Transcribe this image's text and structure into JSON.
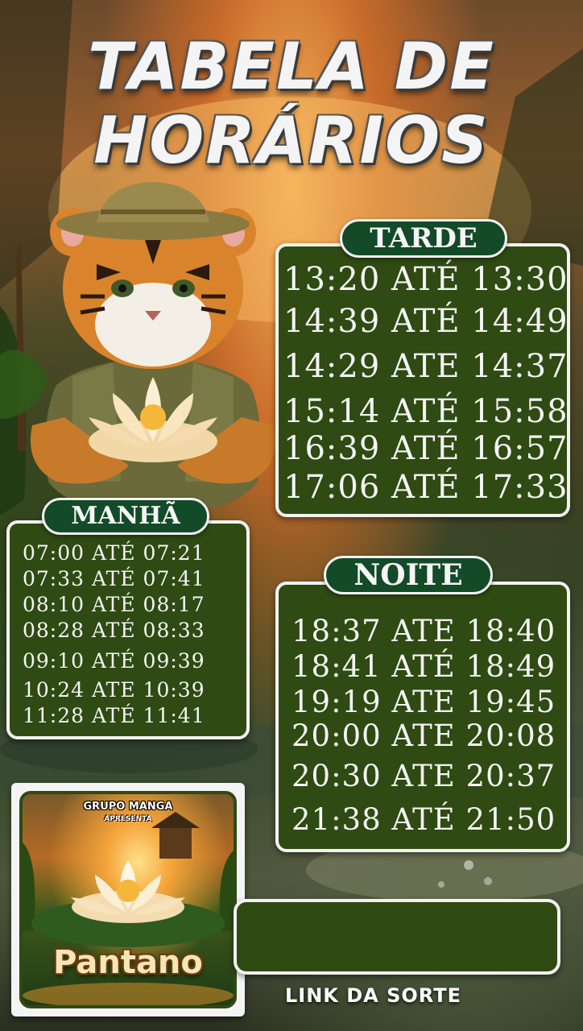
{
  "header": {
    "title_line1": "TABELA DE",
    "title_line2": "HORÁRIOS"
  },
  "sections": {
    "tarde": {
      "label": "TARDE",
      "rows": [
        "13:20 ATÉ 13:30",
        "14:39 ATÉ 14:49",
        "14:29 ATE 14:37",
        "15:14 ATÉ 15:58",
        "16:39 ATÉ 16:57",
        "17:06 ATÉ 17:33"
      ]
    },
    "manha": {
      "label": "MANHÃ",
      "rows": [
        "07:00 ATÉ 07:21",
        "07:33 ATÉ 07:41",
        "08:10 ATÉ 08:17",
        "08:28 ATÉ 08:33",
        "09:10 ATÉ 09:39",
        "10:24 ATE 10:39",
        "11:28 ATÉ 11:41"
      ]
    },
    "noite": {
      "label": "NOITE",
      "rows": [
        "18:37 ATE 18:40",
        "18:41 ATÉ 18:49",
        "19:19 ATE 19:45",
        "20:00 ATE 20:08",
        "20:30 ATE 20:37",
        "21:38 ATÉ 21:50"
      ]
    }
  },
  "game_card": {
    "presenter": "GRUPO MANGA",
    "presents": "APRESENTA",
    "game_name": "Pantano"
  },
  "link": {
    "label": "LINK DA SORTE"
  },
  "colors": {
    "panel_bg": "#2f4a12",
    "pill_bg": "#134a28",
    "border": "#f2f2f2"
  }
}
